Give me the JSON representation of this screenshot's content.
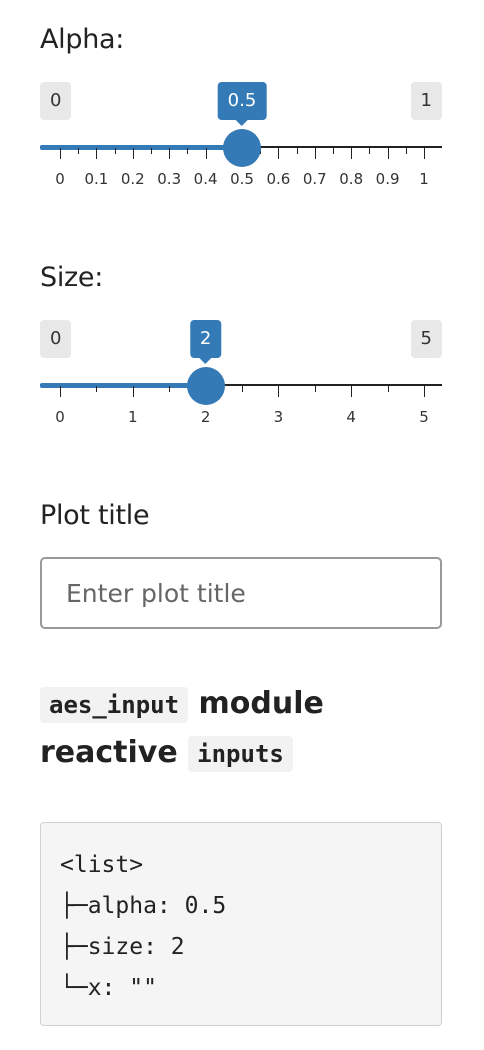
{
  "alpha": {
    "label": "Alpha:",
    "min_label": "0",
    "max_label": "1",
    "current_label": "0.5",
    "min": 0,
    "max": 1,
    "value": 0.5,
    "tick_labels": [
      "0",
      "0.1",
      "0.2",
      "0.3",
      "0.4",
      "0.5",
      "0.6",
      "0.7",
      "0.8",
      "0.9",
      "1"
    ]
  },
  "size": {
    "label": "Size:",
    "min_label": "0",
    "max_label": "5",
    "current_label": "2",
    "min": 0,
    "max": 5,
    "value": 2,
    "tick_labels": [
      "0",
      "1",
      "2",
      "3",
      "4",
      "5"
    ]
  },
  "plot_title": {
    "label": "Plot title",
    "placeholder": "Enter plot title",
    "value": ""
  },
  "section": {
    "code1": "aes_input",
    "text1": "module",
    "text2": "reactive",
    "code2": "inputs"
  },
  "output": {
    "lines": [
      "<list>",
      "├─alpha: 0.5",
      "├─size: 2",
      "└─x: \"\""
    ]
  },
  "colors": {
    "accent": "#337ab7",
    "min_max_bubble": "#e8e8e8",
    "code_background": "#f5f5f5"
  }
}
